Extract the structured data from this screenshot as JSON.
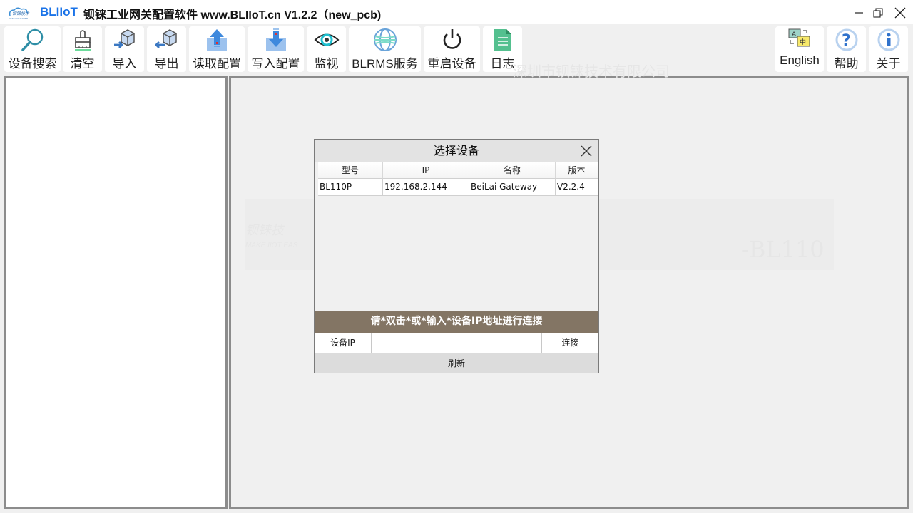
{
  "window": {
    "brand": "BLIIoT",
    "title": "钡铼工业网关配置软件 www.BLIIoT.cn V1.2.2（new_pcb)",
    "controls": {
      "minimize": "minimize-icon",
      "restore": "restore-icon",
      "close": "close-icon"
    }
  },
  "toolbar": {
    "left": [
      {
        "id": "search",
        "label": "设备搜索",
        "icon": "magnifier-icon"
      },
      {
        "id": "clear",
        "label": "清空",
        "icon": "broom-icon"
      },
      {
        "id": "import",
        "label": "导入",
        "icon": "import-box-icon"
      },
      {
        "id": "export",
        "label": "导出",
        "icon": "export-box-icon"
      },
      {
        "id": "read-config",
        "label": "读取配置",
        "icon": "upload-tray-icon"
      },
      {
        "id": "write-config",
        "label": "写入配置",
        "icon": "download-tray-icon"
      },
      {
        "id": "monitor",
        "label": "监视",
        "icon": "eye-icon"
      },
      {
        "id": "blrms",
        "label": "BLRMS服务",
        "icon": "globe-icon"
      },
      {
        "id": "restart",
        "label": "重启设备",
        "icon": "power-icon"
      },
      {
        "id": "log",
        "label": "日志",
        "icon": "document-icon"
      }
    ],
    "right": [
      {
        "id": "language",
        "label": "English",
        "icon": "translate-icon"
      },
      {
        "id": "help",
        "label": "帮助",
        "icon": "question-icon"
      },
      {
        "id": "about",
        "label": "关于",
        "icon": "info-icon"
      }
    ]
  },
  "background": {
    "company_watermark": "深圳市钡铼技术有限公司",
    "model_watermark": "-BL110",
    "logo_watermark": "钡铼技",
    "slogan_watermark": "MAKE IIOT EAS"
  },
  "dialog": {
    "title": "选择设备",
    "columns": [
      "型号",
      "IP",
      "名称",
      "版本"
    ],
    "rows": [
      [
        "BL110P",
        "192.168.2.144",
        "BeiLai Gateway",
        "V2.2.4"
      ]
    ],
    "hint": "请*双击*或*输入*设备IP地址进行连接",
    "ip_label": "设备IP",
    "ip_value": "",
    "connect_label": "连接",
    "refresh_label": "刷新"
  },
  "colors": {
    "brand_blue": "#1a73e8",
    "hint_bar": "#837564",
    "panel_border": "#8c8c8c"
  }
}
